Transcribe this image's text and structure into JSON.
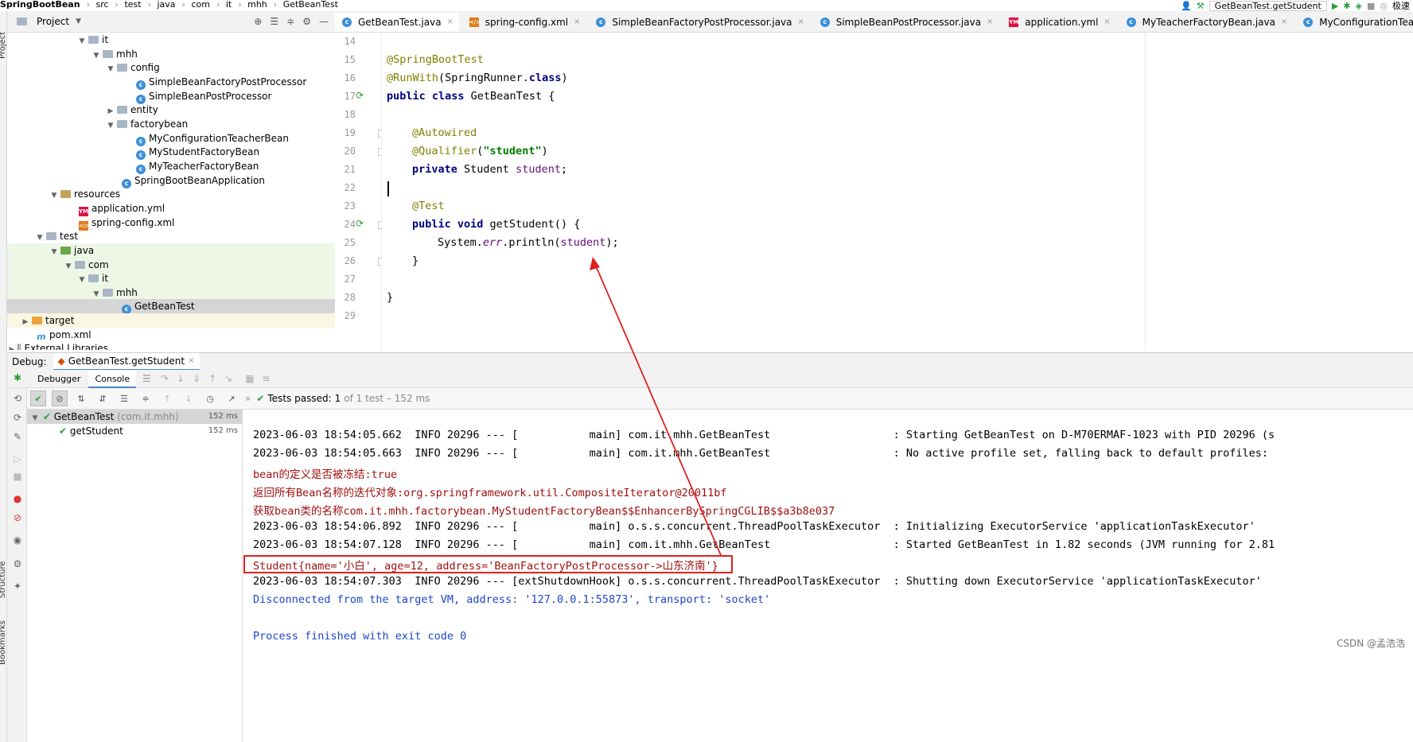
{
  "breadcrumb": [
    "SpringBootBean",
    "src",
    "test",
    "java",
    "com",
    "it",
    "mhh",
    "GetBeanTest"
  ],
  "toolbar": {
    "run_config": "GetBeanTest.getStudent",
    "right_text": "极速"
  },
  "side_labels": {
    "project": "Project",
    "structure": "Structure",
    "bookmarks": "Bookmarks"
  },
  "project_panel": {
    "title": "Project"
  },
  "tree": [
    {
      "label": "it",
      "icon": "folder"
    },
    {
      "label": "mhh",
      "icon": "folder"
    },
    {
      "label": "config",
      "icon": "folder"
    },
    {
      "label": "SimpleBeanFactoryPostProcessor",
      "icon": "class"
    },
    {
      "label": "SimpleBeanPostProcessor",
      "icon": "class"
    },
    {
      "label": "entity",
      "icon": "folder"
    },
    {
      "label": "factorybean",
      "icon": "folder"
    },
    {
      "label": "MyConfigurationTeacherBean",
      "icon": "class"
    },
    {
      "label": "MyStudentFactoryBean",
      "icon": "class"
    },
    {
      "label": "MyTeacherFactoryBean",
      "icon": "class"
    },
    {
      "label": "SpringBootBeanApplication",
      "icon": "class"
    },
    {
      "label": "resources",
      "icon": "folder"
    },
    {
      "label": "application.yml",
      "icon": "yml"
    },
    {
      "label": "spring-config.xml",
      "icon": "xml"
    },
    {
      "label": "test",
      "icon": "folder"
    },
    {
      "label": "java",
      "icon": "folder"
    },
    {
      "label": "com",
      "icon": "folder"
    },
    {
      "label": "it",
      "icon": "folder"
    },
    {
      "label": "mhh",
      "icon": "folder"
    },
    {
      "label": "GetBeanTest",
      "icon": "class"
    },
    {
      "label": "target",
      "icon": "folder"
    },
    {
      "label": "pom.xml",
      "icon": "maven"
    },
    {
      "label": "External Libraries",
      "icon": "library"
    }
  ],
  "tabs": [
    "GetBeanTest.java",
    "spring-config.xml",
    "SimpleBeanFactoryPostProcessor.java",
    "SimpleBeanPostProcessor.java",
    "application.yml",
    "MyTeacherFactoryBean.java",
    "MyConfigurationTeacherBean.java"
  ],
  "line_numbers": [
    "14",
    "15",
    "16",
    "17",
    "18",
    "19",
    "20",
    "21",
    "22",
    "23",
    "24",
    "25",
    "26",
    "27",
    "28",
    "29"
  ],
  "code": {
    "l15": "@SpringBootTest",
    "l16_a": "@RunWith",
    "l16_b": "(SpringRunner.",
    "l16_c": "class",
    "l16_d": ")",
    "l17_a": "public class",
    "l17_b": " GetBeanTest {",
    "l19": "@Autowired",
    "l20_a": "@Qualifier",
    "l20_b": "(",
    "l20_c": "\"student\"",
    "l20_d": ")",
    "l21_a": "private",
    "l21_b": " Student ",
    "l21_c": "student",
    "l21_d": ";",
    "l23": "@Test",
    "l24_a": "public void",
    "l24_b": " getStudent() {",
    "l25_a": "System.",
    "l25_b": "err",
    "l25_c": ".println(",
    "l25_d": "student",
    "l25_e": ");",
    "l26": "}",
    "l28": "}"
  },
  "debug": {
    "label": "Debug:",
    "session": "GetBeanTest.getStudent"
  },
  "subtabs": {
    "debugger": "Debugger",
    "console": "Console"
  },
  "test_status": {
    "passed_text": "Tests passed:",
    "count": "1",
    "rest": "of 1 test – 152 ms"
  },
  "results": [
    {
      "name": "GetBeanTest",
      "pkg": "(com.it.mhh)",
      "time": "152 ms"
    },
    {
      "name": "getStudent",
      "pkg": "",
      "time": "152 ms"
    }
  ],
  "console_lines": [
    {
      "text": "2023-06-03 18:54:05.662  INFO 20296 --- [           main] com.it.mhh.GetBeanTest                   : Starting GetBeanTest on D-M70ERMAF-1023 with PID 20296 (s",
      "kind": "normal"
    },
    {
      "text": "2023-06-03 18:54:05.663  INFO 20296 --- [           main] com.it.mhh.GetBeanTest                   : No active profile set, falling back to default profiles:",
      "kind": "normal"
    },
    {
      "text": "bean的定义是否被冻结:true",
      "kind": "red"
    },
    {
      "text": "返回所有Bean名称的迭代对象:org.springframework.util.CompositeIterator@20011bf",
      "kind": "red"
    },
    {
      "text": "获取bean类的名称com.it.mhh.factorybean.MyStudentFactoryBean$$EnhancerBySpringCGLIB$$a3b8e037",
      "kind": "red"
    },
    {
      "text": "2023-06-03 18:54:06.892  INFO 20296 --- [           main] o.s.s.concurrent.ThreadPoolTaskExecutor  : Initializing ExecutorService 'applicationTaskExecutor'",
      "kind": "normal"
    },
    {
      "text": "2023-06-03 18:54:07.128  INFO 20296 --- [           main] com.it.mhh.GetBeanTest                   : Started GetBeanTest in 1.82 seconds (JVM running for 2.81",
      "kind": "normal"
    },
    {
      "text": "Student{name='小白', age=12, address='BeanFactoryPostProcessor->山东济南'}",
      "kind": "red"
    },
    {
      "text": "2023-06-03 18:54:07.303  INFO 20296 --- [extShutdownHook] o.s.s.concurrent.ThreadPoolTaskExecutor  : Shutting down ExecutorService 'applicationTaskExecutor'",
      "kind": "normal"
    },
    {
      "text": "Disconnected from the target VM, address: '127.0.0.1:55873', transport: 'socket'",
      "kind": "blue"
    },
    {
      "text": "",
      "kind": "normal"
    },
    {
      "text": "Process finished with exit code 0",
      "kind": "blue"
    }
  ],
  "watermark": "CSDN @孟浩浩",
  "colors": {
    "annotation_box": "#e02020",
    "arrow": "#e02020",
    "error_text": "#a01010",
    "info_text": "#1d47c8",
    "keyword": "#000080",
    "string": "#008000"
  }
}
